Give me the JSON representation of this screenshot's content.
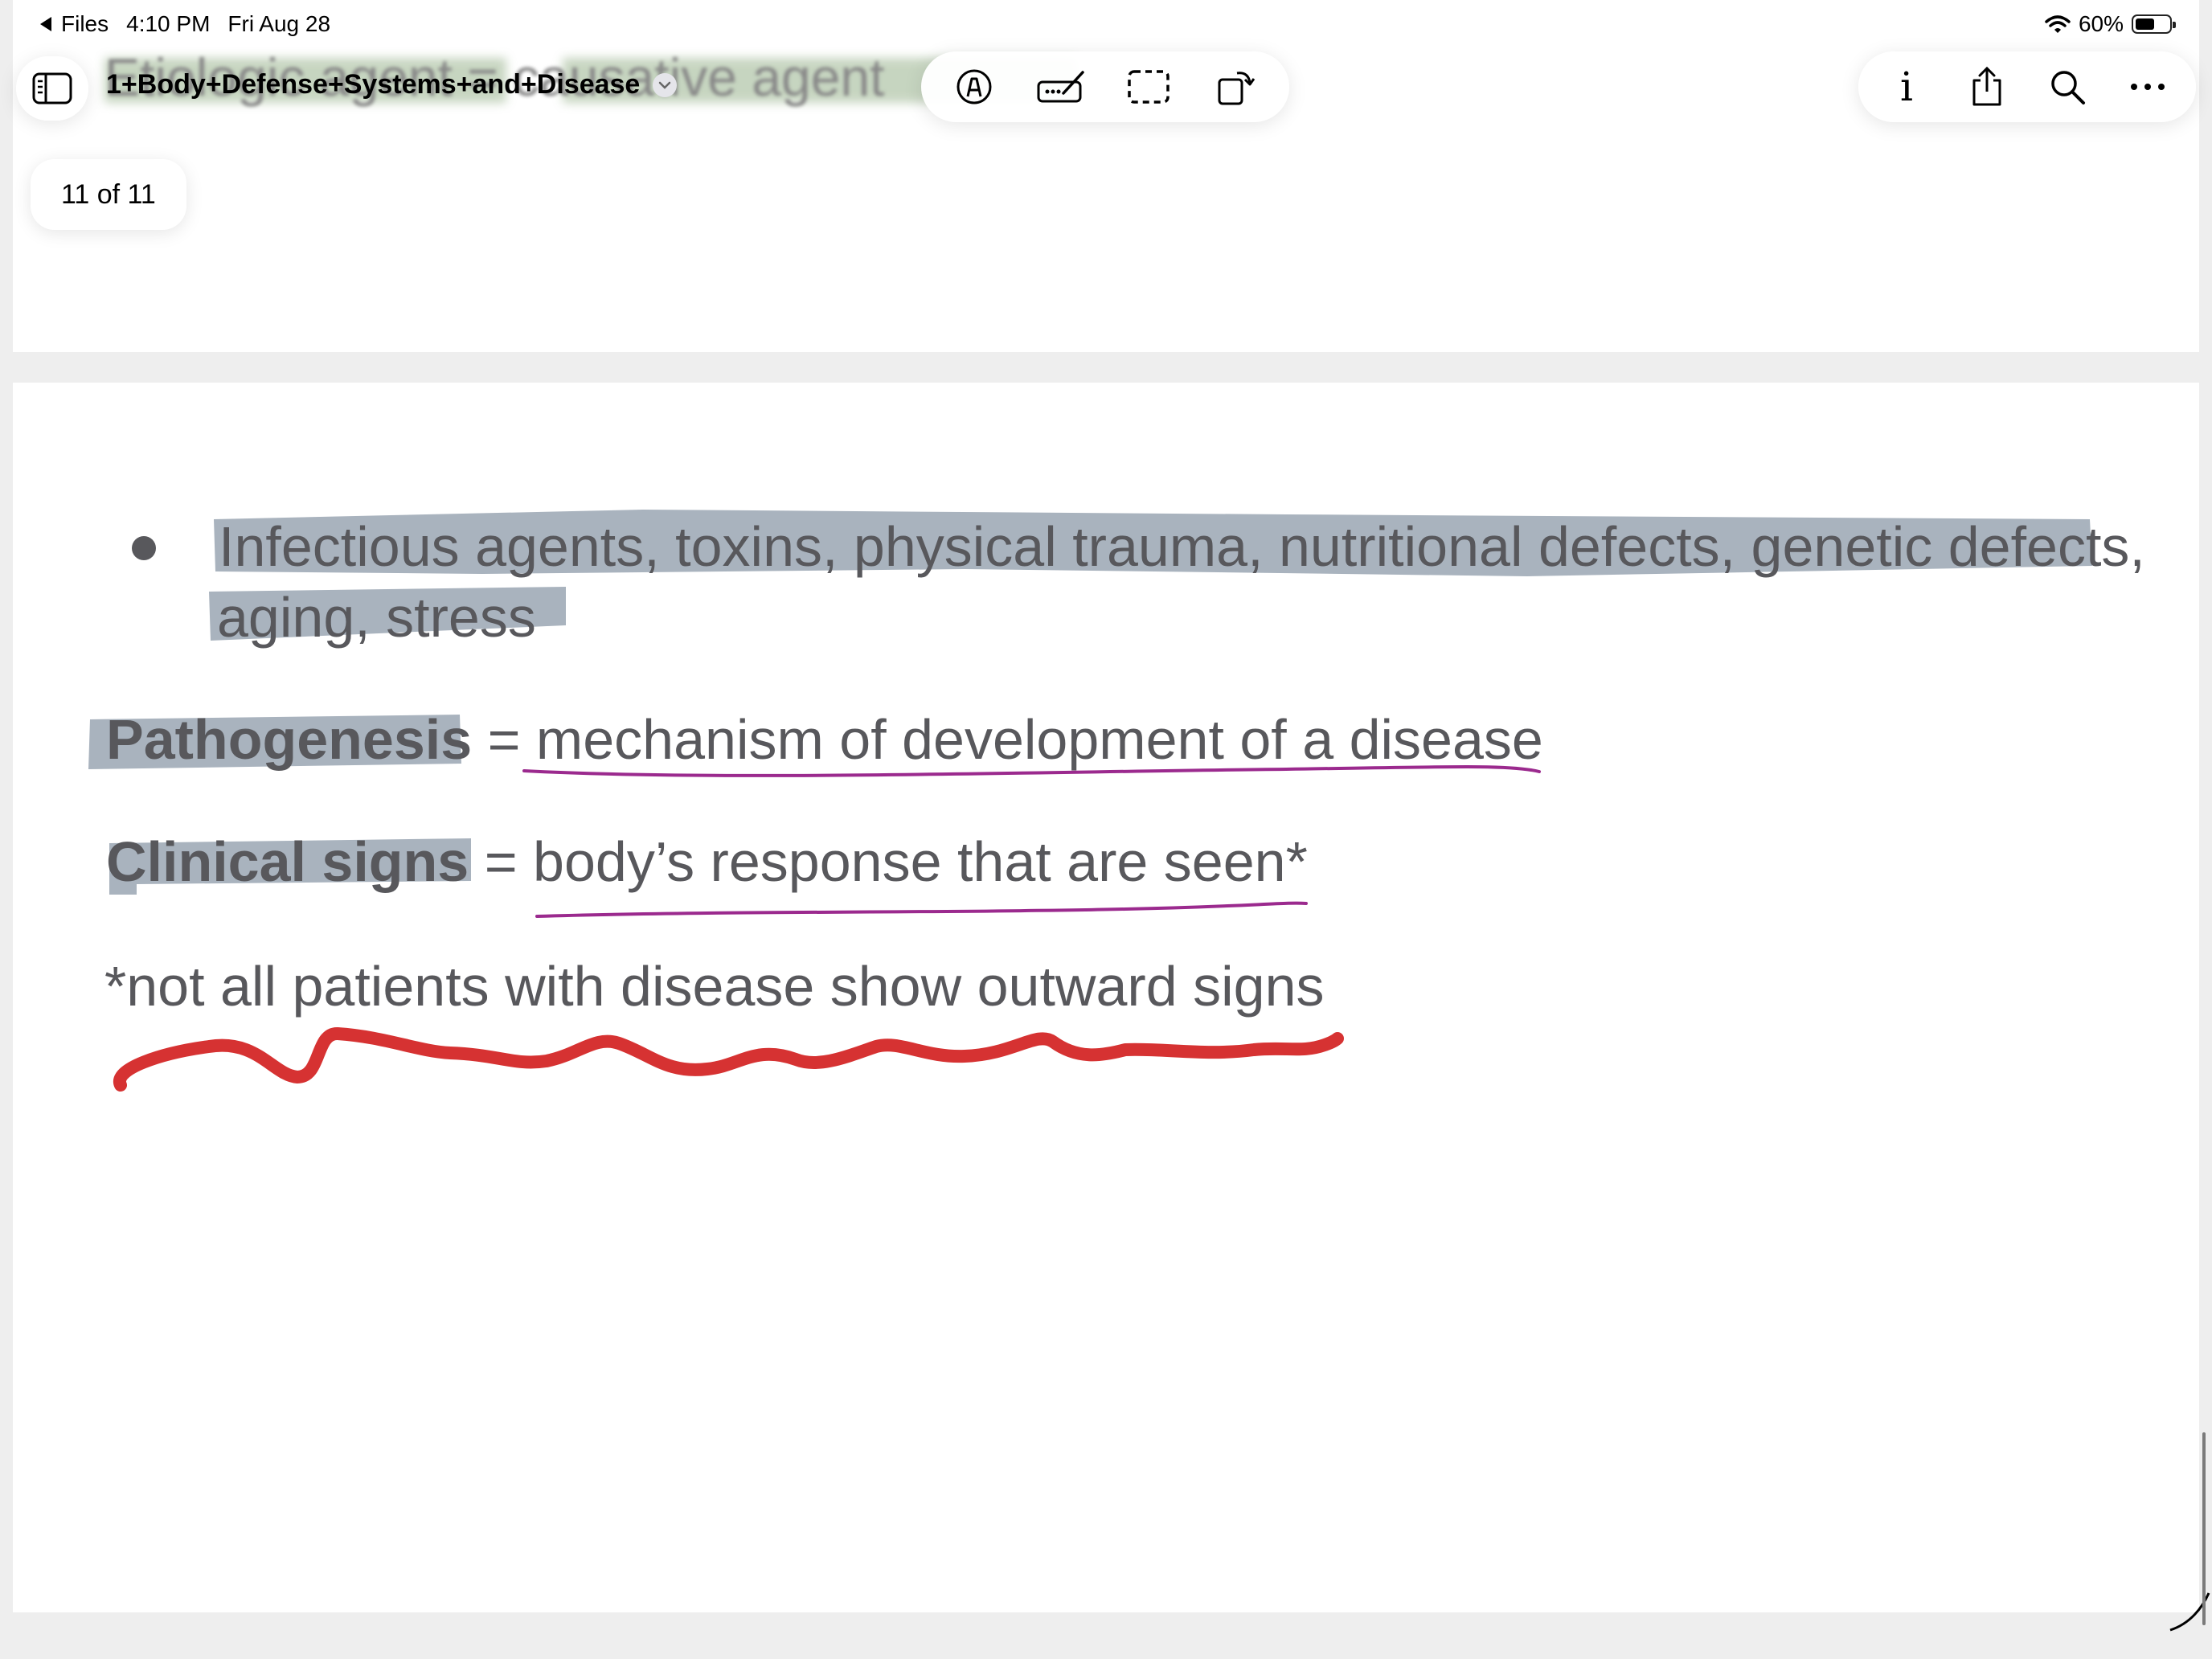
{
  "status_bar": {
    "back_label": "Files",
    "time": "4:10 PM",
    "date": "Fri Aug 28",
    "battery": "60%",
    "battery_level": 0.6,
    "icons": [
      "back-arrow-icon",
      "wifi-icon",
      "battery-icon"
    ]
  },
  "toolbar": {
    "document_title": "1+Body+Defense+Systems+and+Disease",
    "markup_tools": [
      "pen-tip-icon",
      "signature-icon",
      "selection-icon",
      "rotate-page-icon"
    ],
    "actions": [
      "info-icon",
      "share-icon",
      "search-icon",
      "more-icon"
    ],
    "info_label": "i"
  },
  "page_counter": "11 of 11",
  "previous_page_ghost_text": "Etiologic agent = causative agent",
  "document": {
    "bullet_line_1": "Infectious agents, toxins, physical trauma, nutritional defects, genetic defects,",
    "bullet_line_2": "aging, stress",
    "pathogenesis_term": "Pathogenesis",
    "pathogenesis_eq": " = mechanism of development of a disease",
    "clinical_term": "Clinical signs",
    "clinical_eq": " = body’s response that are seen*",
    "footnote": "*not all patients with disease show outward signs"
  },
  "colors": {
    "highlight": "#a9b3be",
    "underline_purple": "#9b2a8e",
    "squiggle_red": "#d63232",
    "text": "#58585c"
  }
}
